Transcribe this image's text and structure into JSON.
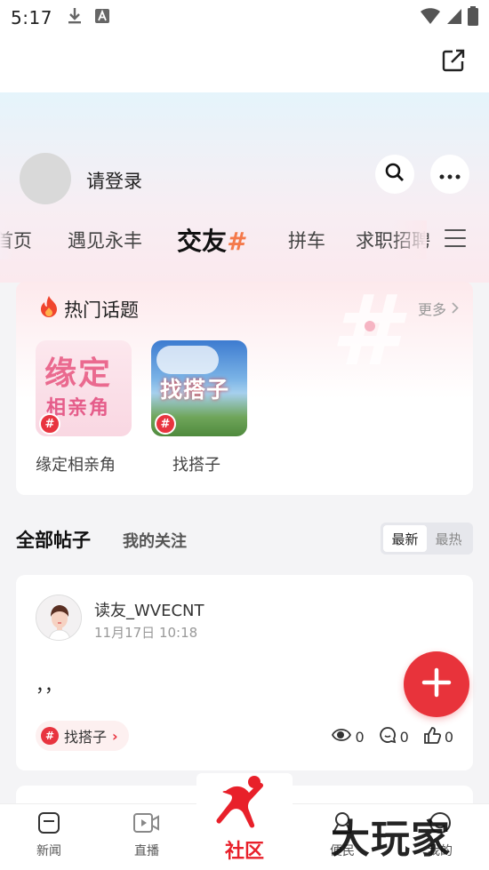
{
  "status_bar": {
    "time": "5:17"
  },
  "header": {
    "login_text": "请登录"
  },
  "tabs": [
    {
      "label": "首页"
    },
    {
      "label": "遇见永丰"
    },
    {
      "label": "交友"
    },
    {
      "label": "拼车"
    },
    {
      "label": "求职招聘"
    }
  ],
  "active_tab_hash": "#",
  "hot_topics": {
    "title": "热门话题",
    "more_label": "更多",
    "items": [
      {
        "name": "缘定相亲角",
        "thumb_line1": "缘定",
        "thumb_line2": "相亲角"
      },
      {
        "name": "找搭子",
        "thumb_line1": "找搭子"
      }
    ]
  },
  "filters": {
    "all_posts": "全部帖子",
    "my_follows": "我的关注",
    "sort_options": [
      "最新",
      "最热"
    ],
    "sort_selected": "最新"
  },
  "post": {
    "username": "读友_WVECNT",
    "time": "11月17日 10:18",
    "content": "，，",
    "tag": "找搭子",
    "views": "0",
    "comments": "0",
    "likes": "0"
  },
  "bottom_nav": {
    "items": [
      "新闻",
      "直播",
      "社区",
      "便民",
      "我的"
    ]
  },
  "watermark": "大玩家",
  "colors": {
    "accent": "#e8333b",
    "tag_hash": "#f47a4b"
  }
}
